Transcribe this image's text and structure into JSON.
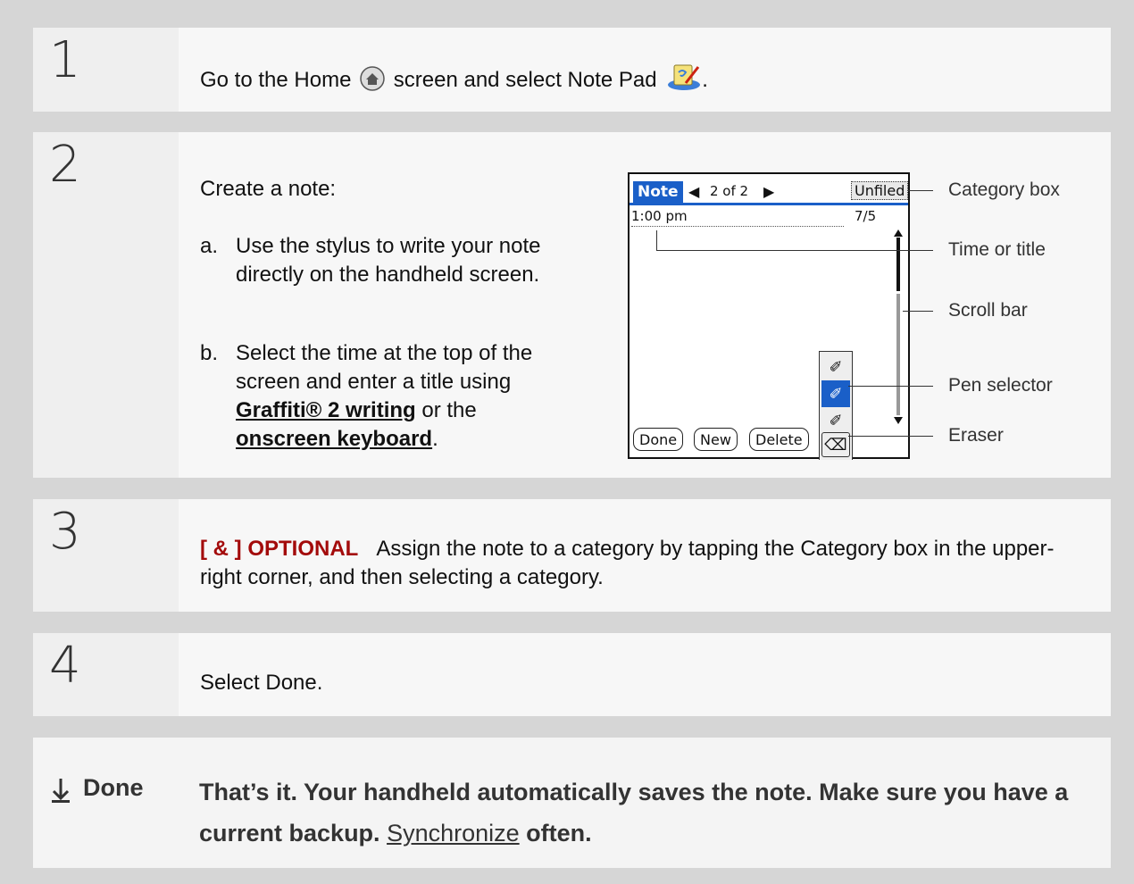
{
  "steps": [
    {
      "number": "1",
      "text_before": "Go to the Home",
      "text_mid": "screen and select Note Pad",
      "text_end": "."
    },
    {
      "number": "2",
      "intro": "Create a note:",
      "item_a_marker": "a.",
      "item_a": "Use the stylus to write your note directly on the handheld screen.",
      "item_b_marker": "b.",
      "item_b_pre": "Select the time at the top of the screen and enter a title using ",
      "item_b_link1": "Graffiti® 2 writing",
      "item_b_mid": " or the ",
      "item_b_link2": "onscreen keyboard",
      "item_b_end": "."
    },
    {
      "number": "3",
      "optional": "[ & ]  OPTIONAL",
      "text": "Assign the note to a category by tapping the Category box in the upper-right corner, and then selecting a category."
    },
    {
      "number": "4",
      "text": "Select Done."
    }
  ],
  "device": {
    "tab": "Note",
    "pager": "2 of 2",
    "category": "Unfiled",
    "time": "1:00 pm",
    "date": "7/5",
    "buttons": [
      "Done",
      "New",
      "Delete"
    ]
  },
  "callouts": [
    "Category box",
    "Time or title",
    "Scroll bar",
    "Pen selector",
    "Eraser"
  ],
  "done": {
    "label": "Done",
    "text_pre": "That’s it. Your handheld automatically saves the note. Make sure you have a current backup. ",
    "link": "Synchronize",
    "text_post": " often."
  },
  "colors": {
    "accent": "#a30b0b",
    "device_highlight": "#1a5fc8"
  }
}
